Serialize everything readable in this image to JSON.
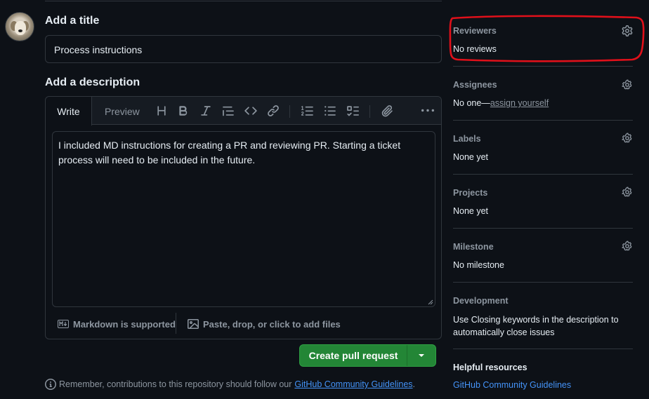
{
  "form": {
    "title_heading": "Add a title",
    "title_value": "Process instructions",
    "description_heading": "Add a description",
    "tabs": {
      "write": "Write",
      "preview": "Preview"
    },
    "body_text": "I included MD instructions for creating a PR and reviewing PR. Starting a ticket process will need to be included in the future.",
    "markdown_note": "Markdown is supported",
    "attach_note": "Paste, drop, or click to add files",
    "create_button": "Create pull request",
    "guidelines_prefix": "Remember, contributions to this repository should follow our",
    "guidelines_link": "GitHub Community Guidelines",
    "guidelines_suffix": "."
  },
  "sidebar": {
    "reviewers": {
      "label": "Reviewers",
      "value": "No reviews"
    },
    "assignees": {
      "label": "Assignees",
      "value_prefix": "No one—",
      "assign_link": "assign yourself"
    },
    "labels": {
      "label": "Labels",
      "value": "None yet"
    },
    "projects": {
      "label": "Projects",
      "value": "None yet"
    },
    "milestone": {
      "label": "Milestone",
      "value": "No milestone"
    },
    "development": {
      "label": "Development",
      "text_prefix": "Use",
      "link": "Closing keywords",
      "text_suffix": "in the description to automatically close issues"
    },
    "helpful": {
      "label": "Helpful resources",
      "link": "GitHub Community Guidelines"
    }
  },
  "colors": {
    "accent_green": "#238636",
    "link_blue": "#4493f8",
    "annotation_red": "#e0101a"
  },
  "icons": [
    "heading-icon",
    "bold-icon",
    "italic-icon",
    "quote-icon",
    "code-icon",
    "link-icon",
    "ordered-list-icon",
    "unordered-list-icon",
    "task-list-icon",
    "attach-icon",
    "more-icon",
    "markdown-icon",
    "image-icon",
    "gear-icon",
    "info-icon",
    "caret-down-icon"
  ]
}
